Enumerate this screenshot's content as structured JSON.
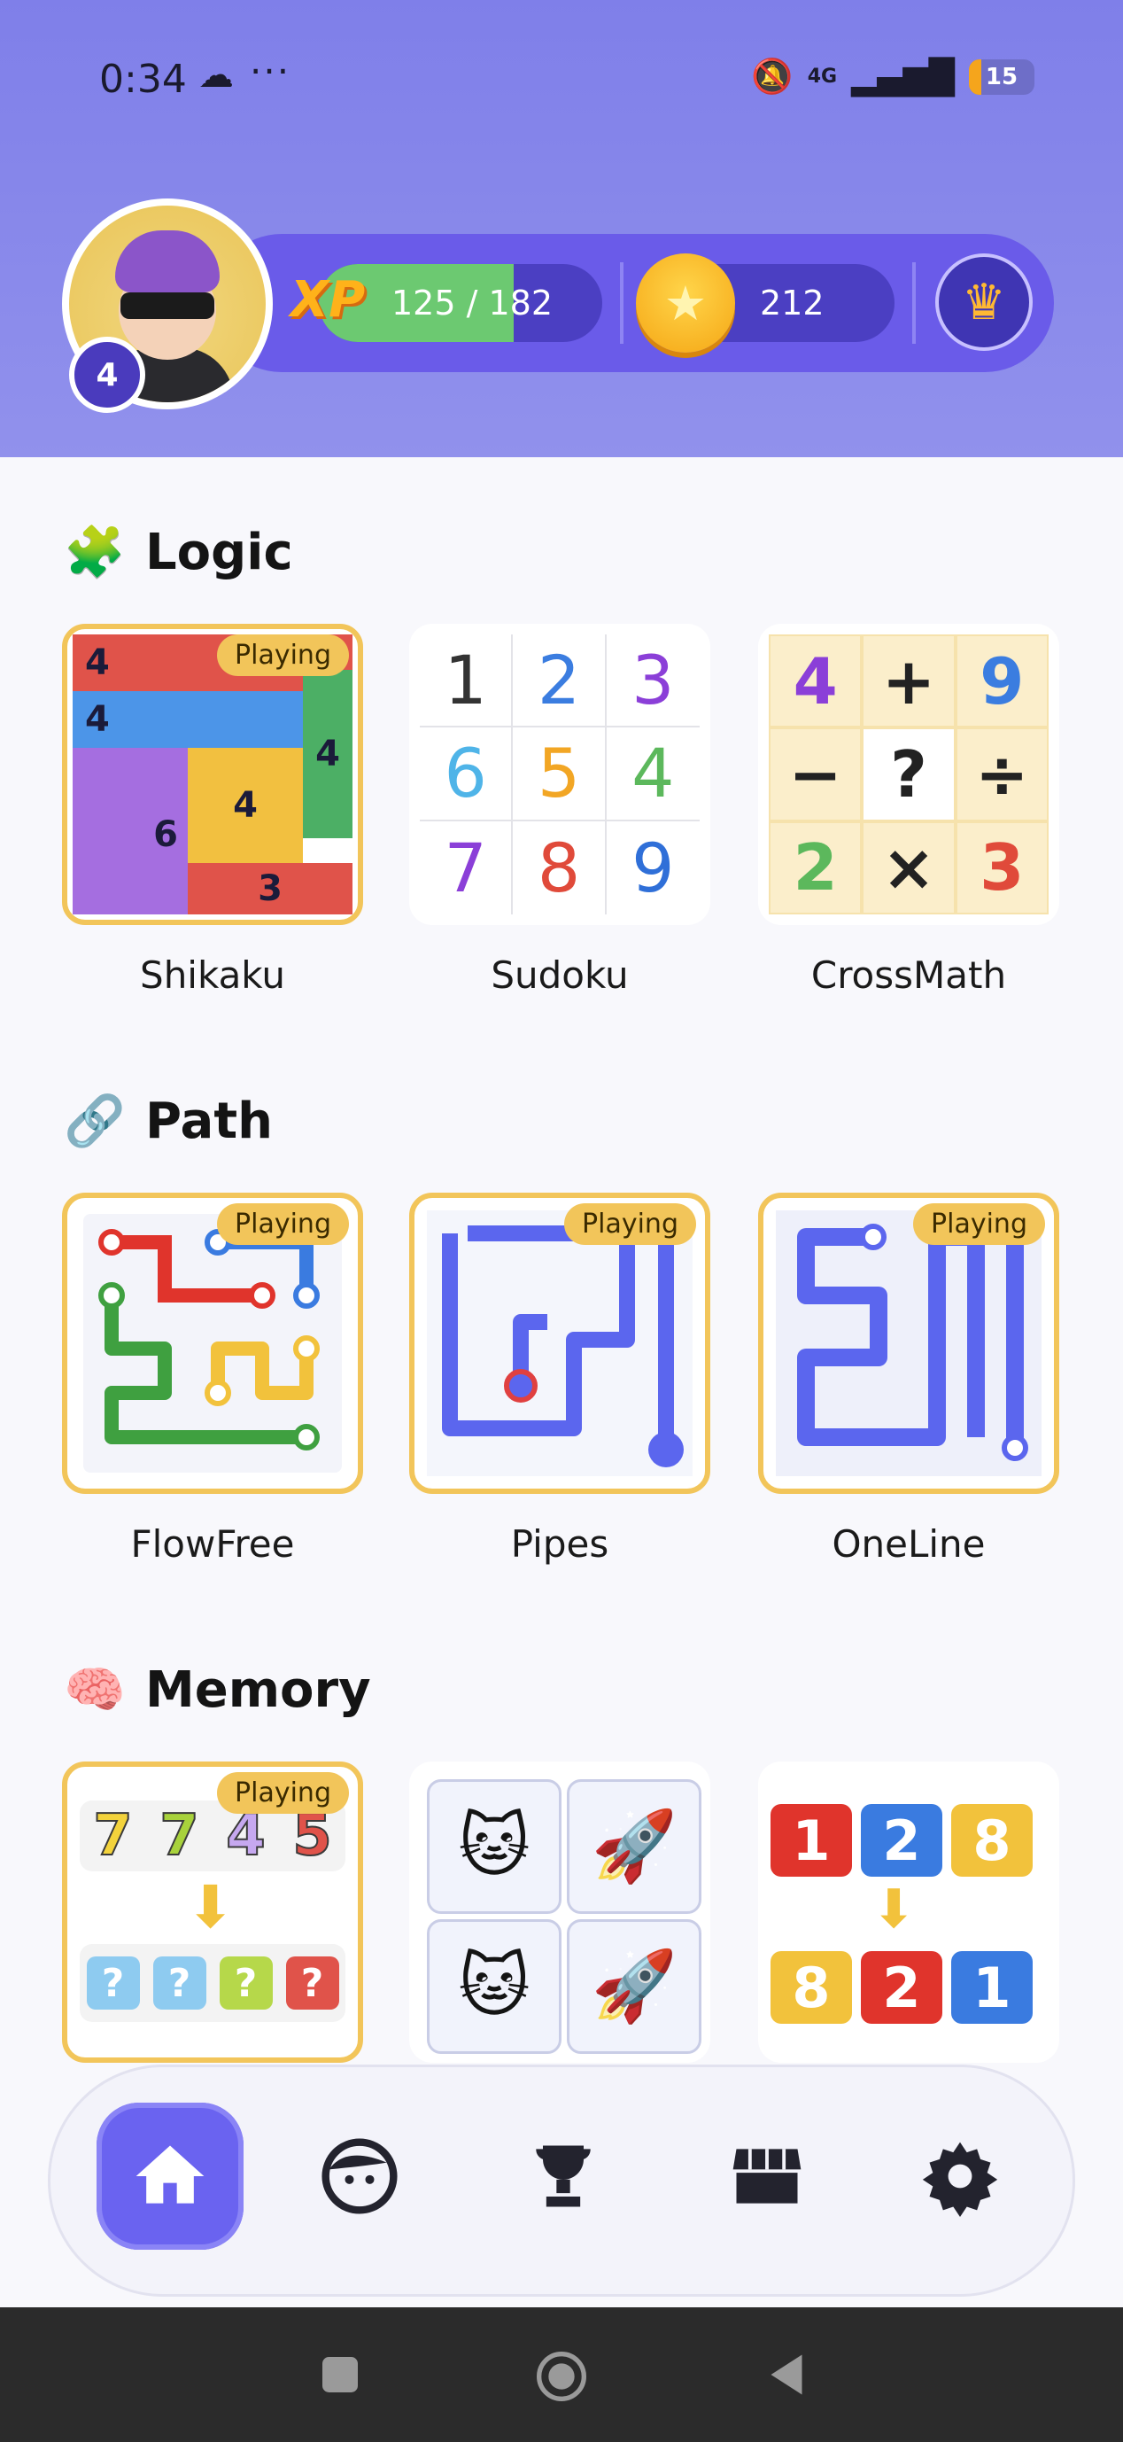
{
  "status_bar": {
    "time": "0:34",
    "cloud_icon": "cloud-icon",
    "more": "···",
    "network": "4G",
    "battery": "15"
  },
  "profile": {
    "level": "4",
    "xp_label": "XP",
    "xp_text": "125 / 182",
    "xp_progress": 0.6868,
    "coins": "212"
  },
  "sections": [
    {
      "title": "Logic",
      "icon": "puzzle-icon",
      "games": [
        {
          "name": "Shikaku",
          "badge": "Playing"
        },
        {
          "name": "Sudoku",
          "badge": ""
        },
        {
          "name": "CrossMath",
          "badge": ""
        }
      ]
    },
    {
      "title": "Path",
      "icon": "link-icon",
      "games": [
        {
          "name": "FlowFree",
          "badge": "Playing"
        },
        {
          "name": "Pipes",
          "badge": "Playing"
        },
        {
          "name": "OneLine",
          "badge": "Playing"
        }
      ]
    },
    {
      "title": "Memory",
      "icon": "brain-icon",
      "games": [
        {
          "name": "",
          "badge": "Playing"
        },
        {
          "name": "",
          "badge": ""
        },
        {
          "name": "",
          "badge": ""
        }
      ]
    }
  ],
  "shikaku_numbers": [
    "4",
    "4",
    "4",
    "4",
    "6",
    "3"
  ],
  "sudoku_digits": [
    "1",
    "2",
    "3",
    "6",
    "5",
    "4",
    "7",
    "8",
    "9"
  ],
  "sudoku_colors": [
    "#333333",
    "#3b7de0",
    "#8b3fd8",
    "#4fb4e8",
    "#f2a624",
    "#5cb85c",
    "#8b3fd8",
    "#e04a3a",
    "#2f6fd8"
  ],
  "crossmath": [
    "4",
    "+",
    "9",
    "−",
    "?",
    "÷",
    "2",
    "×",
    "3"
  ],
  "crossmath_colors": [
    "#8b3fd8",
    "#222222",
    "#3b7de0",
    "#222222",
    "#222222",
    "#222222",
    "#5cb85c",
    "#222222",
    "#e04a3a"
  ],
  "memory_sequence": {
    "top": [
      "7",
      "7",
      "4",
      "5"
    ],
    "bottom": [
      "?",
      "?",
      "?",
      "?"
    ]
  },
  "memory_pairs": [
    "cat-face-icon",
    "rocket-icon",
    "cat-face-icon",
    "rocket-icon"
  ],
  "memory_order": {
    "top": [
      "1",
      "2",
      "8"
    ],
    "bottom": [
      "8",
      "2",
      "1"
    ]
  },
  "bottom_nav": [
    {
      "name": "home",
      "icon": "home-icon",
      "active": true
    },
    {
      "name": "profile",
      "icon": "face-icon",
      "active": false
    },
    {
      "name": "trophy",
      "icon": "trophy-icon",
      "active": false
    },
    {
      "name": "store",
      "icon": "store-icon",
      "active": false
    },
    {
      "name": "settings",
      "icon": "gear-icon",
      "active": false
    }
  ],
  "colors": {
    "header": "#8b8bec",
    "accent": "#6a63f0",
    "badge": "#f2c55a",
    "xp_fill": "#6cc971"
  }
}
